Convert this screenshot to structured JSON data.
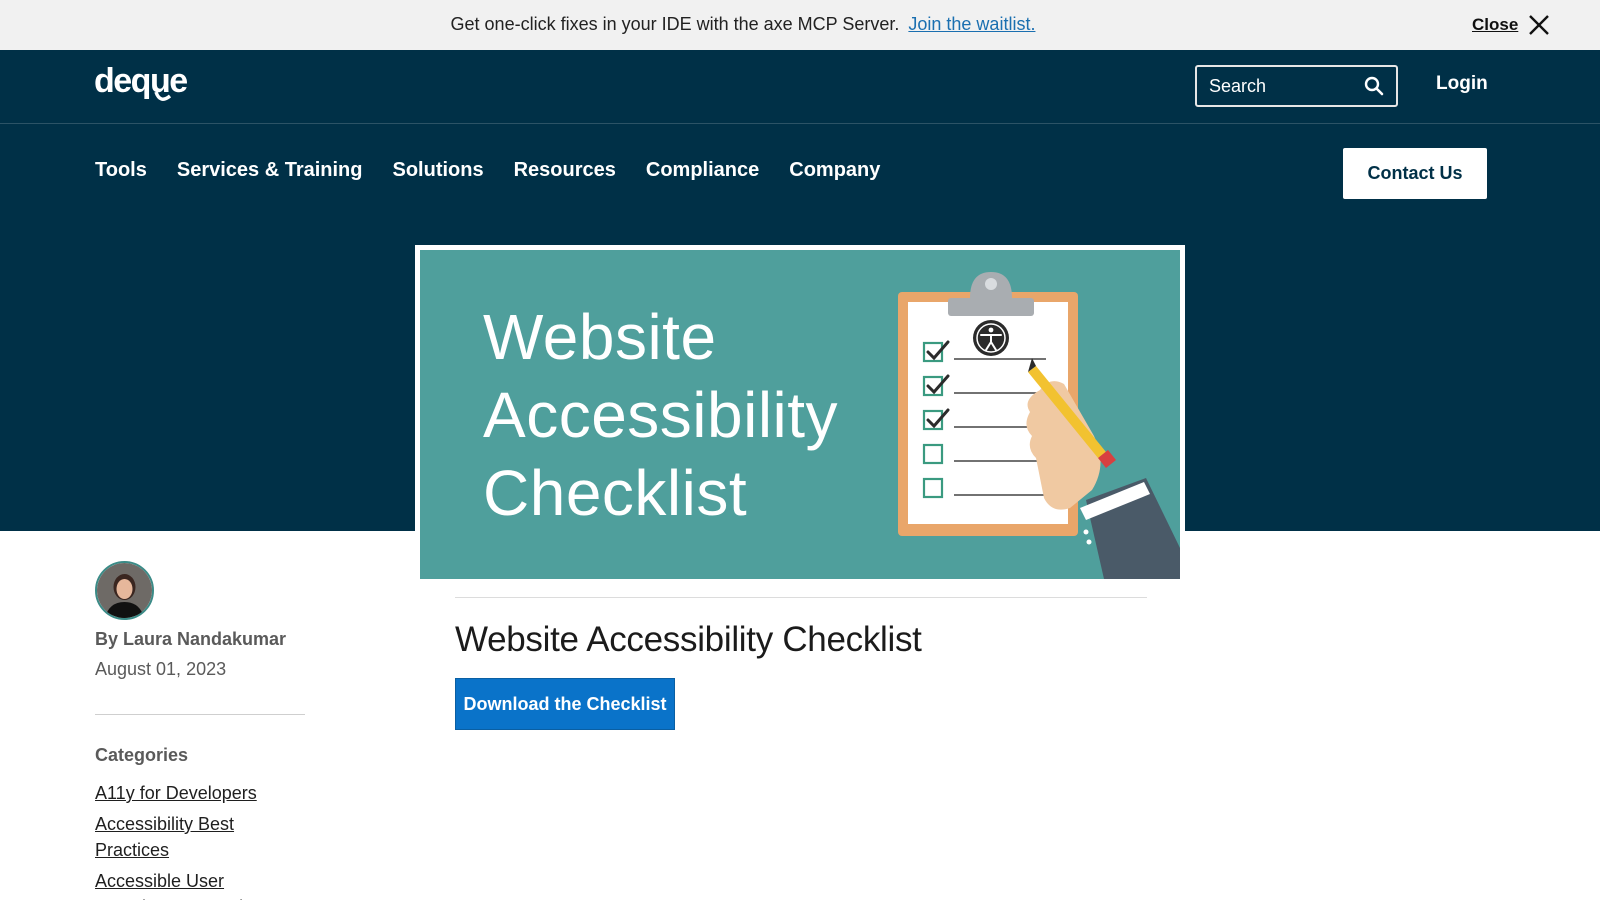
{
  "announcement": {
    "text": "Get one-click fixes in your IDE with the axe MCP Server.",
    "link_label": "Join the waitlist.",
    "close_label": "Close"
  },
  "header": {
    "logo_text": "deque",
    "search_placeholder": "Search",
    "login_label": "Login",
    "nav": [
      "Tools",
      "Services & Training",
      "Solutions",
      "Resources",
      "Compliance",
      "Company"
    ],
    "contact_label": "Contact Us"
  },
  "hero": {
    "title_lines": [
      "Website",
      "Accessibility",
      "Checklist"
    ]
  },
  "sidebar": {
    "byline": "By Laura Nandakumar",
    "date": "August 01, 2023",
    "categories_heading": "Categories",
    "categories": [
      "A11y for Developers",
      "Accessibility Best Practices",
      "Accessible User Experience & Design"
    ]
  },
  "article": {
    "title": "Website Accessibility Checklist",
    "download_label": "Download the Checklist"
  },
  "colors": {
    "header_bg": "#003047",
    "hero_bg": "#4f9f9c",
    "primary_button": "#0a73c9",
    "link": "#1a6fb0"
  },
  "icons": [
    "close-icon",
    "search-icon",
    "accessibility-icon",
    "checkbox-icon",
    "pencil-icon"
  ]
}
